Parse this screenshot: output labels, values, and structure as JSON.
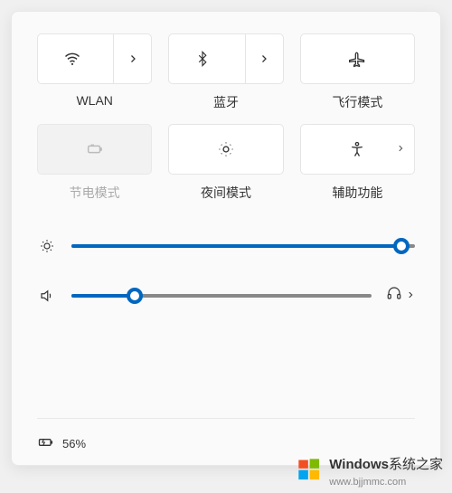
{
  "tiles": {
    "wlan": {
      "label": "WLAN"
    },
    "bluetooth": {
      "label": "蓝牙"
    },
    "airplane": {
      "label": "飞行模式"
    },
    "battery_saver": {
      "label": "节电模式"
    },
    "night_light": {
      "label": "夜间模式"
    },
    "accessibility": {
      "label": "辅助功能"
    }
  },
  "sliders": {
    "brightness": {
      "value": 96
    },
    "volume": {
      "value": 21
    }
  },
  "status": {
    "battery_percent": "56%"
  },
  "watermark": {
    "brand": "Windows",
    "site": "系统之家",
    "domain": "www.bjjmmc.com"
  }
}
